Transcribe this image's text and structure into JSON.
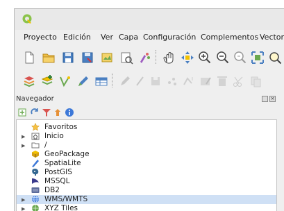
{
  "menubar": {
    "items": [
      "Proyecto",
      "Edición",
      "Ver",
      "Capa",
      "Configuración",
      "Complementos",
      "Vectorial"
    ]
  },
  "navigator": {
    "title": "Navegador",
    "items": [
      {
        "label": "Favoritos",
        "icon": "star-icon",
        "expandable": false,
        "selected": false
      },
      {
        "label": "Inicio",
        "icon": "home-folder-icon",
        "expandable": true,
        "selected": false
      },
      {
        "label": "/",
        "icon": "folder-icon",
        "expandable": true,
        "selected": false
      },
      {
        "label": "GeoPackage",
        "icon": "geopackage-icon",
        "expandable": false,
        "selected": false
      },
      {
        "label": "SpatiaLite",
        "icon": "spatialite-icon",
        "expandable": false,
        "selected": false
      },
      {
        "label": "PostGIS",
        "icon": "postgis-icon",
        "expandable": false,
        "selected": false
      },
      {
        "label": "MSSQL",
        "icon": "mssql-icon",
        "expandable": false,
        "selected": false
      },
      {
        "label": "DB2",
        "icon": "db2-icon",
        "expandable": false,
        "selected": false
      },
      {
        "label": "WMS/WMTS",
        "icon": "wms-globe-icon",
        "expandable": true,
        "selected": true
      },
      {
        "label": "XYZ Tiles",
        "icon": "xyz-tiles-icon",
        "expandable": true,
        "selected": false
      }
    ]
  },
  "colors": {
    "selection": "#cfe0f5",
    "qgis_green": "#8bc34a",
    "qgis_yellow": "#f2c200"
  }
}
